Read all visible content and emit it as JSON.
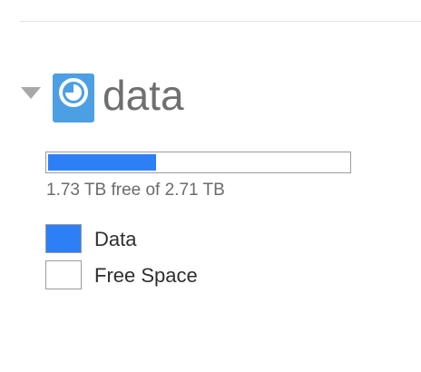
{
  "volume": {
    "name": "data",
    "icon": "timemachine-volume-icon",
    "capacity_text": "1.73 TB free of 2.71 TB",
    "used_fraction": 0.36,
    "colors": {
      "icon": "#4c9fe3",
      "used": "#2d7ff6",
      "free": "#ffffff"
    }
  },
  "legend": {
    "items": [
      {
        "label": "Data",
        "color": "#2d7ff6"
      },
      {
        "label": "Free Space",
        "color": "#ffffff"
      }
    ]
  }
}
